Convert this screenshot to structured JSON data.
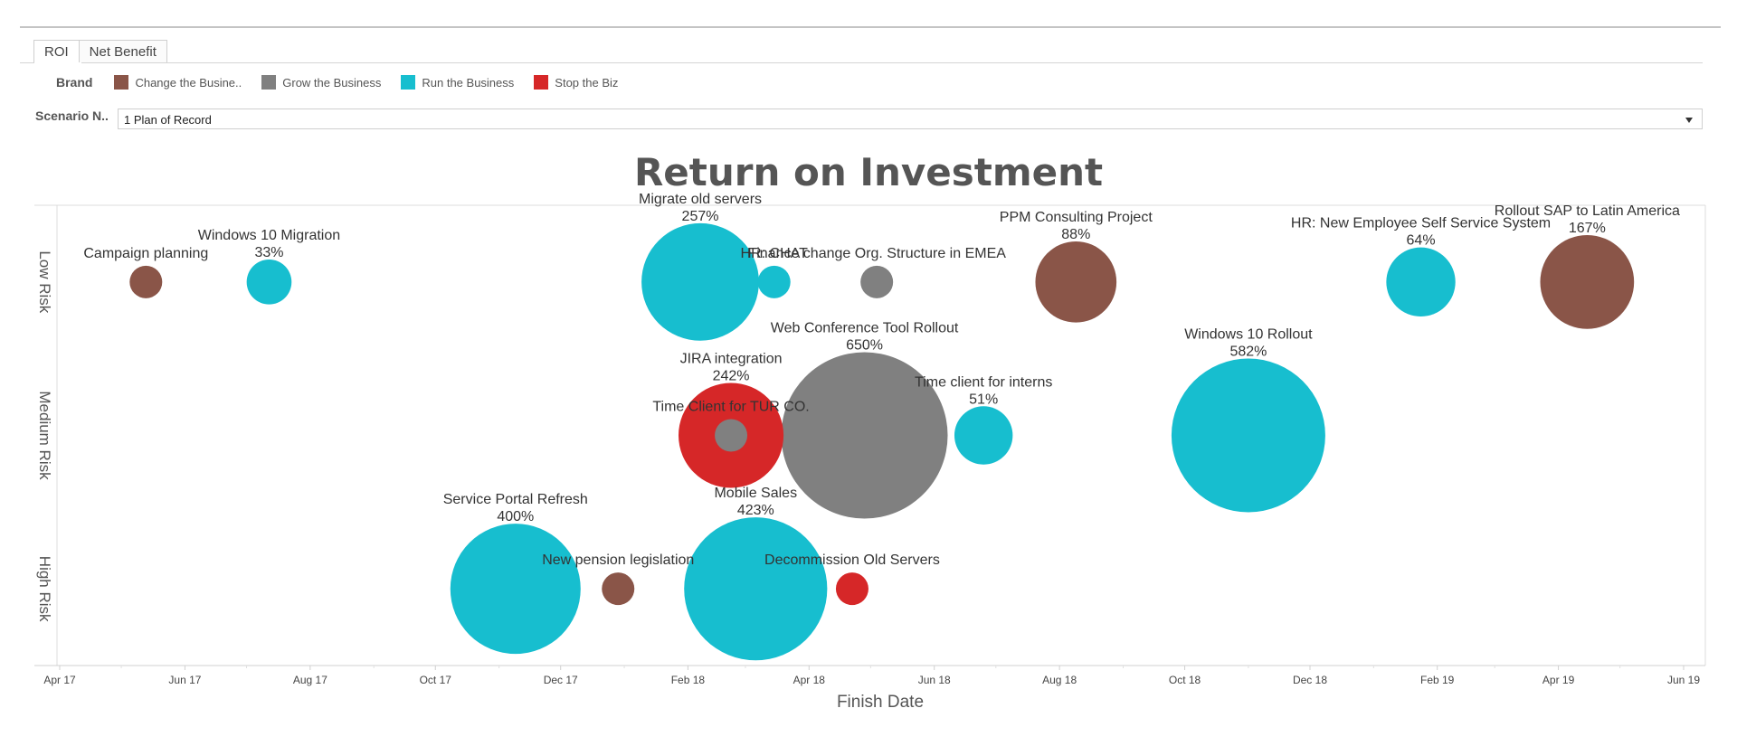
{
  "tabs": [
    {
      "label": "ROI",
      "active": true
    },
    {
      "label": "Net Benefit",
      "active": false
    }
  ],
  "legend": {
    "title": "Brand",
    "items": [
      {
        "label": "Change the Busine..",
        "color": "#8a5548"
      },
      {
        "label": "Grow the Business",
        "color": "#808080"
      },
      {
        "label": "Run the Business",
        "color": "#17becf"
      },
      {
        "label": "Stop the Biz",
        "color": "#d62728"
      }
    ]
  },
  "filter": {
    "label": "Scenario N..",
    "value": "1 Plan of Record"
  },
  "chart_data": {
    "type": "scatter",
    "subtype": "bubble",
    "title": "Return on Investment",
    "xlabel": "Finish Date",
    "ylabel": "",
    "x_ticks": [
      "Apr 17",
      "Jun 17",
      "Aug 17",
      "Oct 17",
      "Dec 17",
      "Feb 18",
      "Apr 18",
      "Jun 18",
      "Aug 18",
      "Oct 18",
      "Dec 18",
      "Feb 19",
      "Apr 19",
      "Jun 19"
    ],
    "x_range": [
      "2017-03-15",
      "2019-06-25"
    ],
    "y_categories": [
      "Low Risk",
      "Medium Risk",
      "High Risk"
    ],
    "legend_position": "top-left",
    "grid": false,
    "points": [
      {
        "name": "Campaign planning",
        "roi": "",
        "brand": "Change the Business",
        "risk": "Low Risk",
        "finish": "2017-05-13",
        "size": 1.0
      },
      {
        "name": "Windows 10 Migration",
        "roi": "33%",
        "brand": "Run the Business",
        "risk": "Low Risk",
        "finish": "2017-07-12",
        "size": 1.9
      },
      {
        "name": "Migrate old servers",
        "roi": "257%",
        "brand": "Run the Business",
        "risk": "Low Risk",
        "finish": "2018-02-07",
        "size": 13.0
      },
      {
        "name": "HR: CHAT",
        "roi": "",
        "brand": "Run the Business",
        "risk": "Low Risk",
        "finish": "2018-03-15",
        "size": 1.0
      },
      {
        "name": "Finance change Org. Structure in EMEA",
        "roi": "",
        "brand": "Grow the Business",
        "risk": "Low Risk",
        "finish": "2018-05-04",
        "size": 1.0
      },
      {
        "name": "PPM Consulting Project",
        "roi": "88%",
        "brand": "Change the Business",
        "risk": "Low Risk",
        "finish": "2018-08-09",
        "size": 6.2
      },
      {
        "name": "HR: New Employee Self Service System",
        "roi": "64%",
        "brand": "Run the Business",
        "risk": "Low Risk",
        "finish": "2019-01-24",
        "size": 4.5
      },
      {
        "name": "Rollout SAP to Latin America",
        "roi": "167%",
        "brand": "Change the Business",
        "risk": "Low Risk",
        "finish": "2019-04-15",
        "size": 8.3
      },
      {
        "name": "JIRA integration",
        "roi": "242%",
        "brand": "Stop the Biz",
        "risk": "Medium Risk",
        "finish": "2018-02-22",
        "size": 10.4
      },
      {
        "name": "Time Client for TUR CO.",
        "roi": "",
        "brand": "Grow the Business",
        "risk": "Medium Risk",
        "finish": "2018-02-22",
        "size": 1.0
      },
      {
        "name": "Web Conference Tool Rollout",
        "roi": "650%",
        "brand": "Grow the Business",
        "risk": "Medium Risk",
        "finish": "2018-04-28",
        "size": 26.1
      },
      {
        "name": "Time client for interns",
        "roi": "51%",
        "brand": "Run the Business",
        "risk": "Medium Risk",
        "finish": "2018-06-25",
        "size": 3.2
      },
      {
        "name": "Windows 10 Rollout",
        "roi": "582%",
        "brand": "Run the Business",
        "risk": "Medium Risk",
        "finish": "2018-11-01",
        "size": 22.3
      },
      {
        "name": "Service Portal Refresh",
        "roi": "400%",
        "brand": "Run the Business",
        "risk": "High Risk",
        "finish": "2017-11-09",
        "size": 16.0
      },
      {
        "name": "New pension legislation",
        "roi": "",
        "brand": "Change the Business",
        "risk": "High Risk",
        "finish": "2017-12-29",
        "size": 1.0
      },
      {
        "name": "Mobile Sales",
        "roi": "423%",
        "brand": "Run the Business",
        "risk": "High Risk",
        "finish": "2018-03-06",
        "size": 19.3
      },
      {
        "name": "Decommission Old Servers",
        "roi": "",
        "brand": "Stop the Biz",
        "risk": "High Risk",
        "finish": "2018-04-22",
        "size": 1.0
      }
    ]
  }
}
